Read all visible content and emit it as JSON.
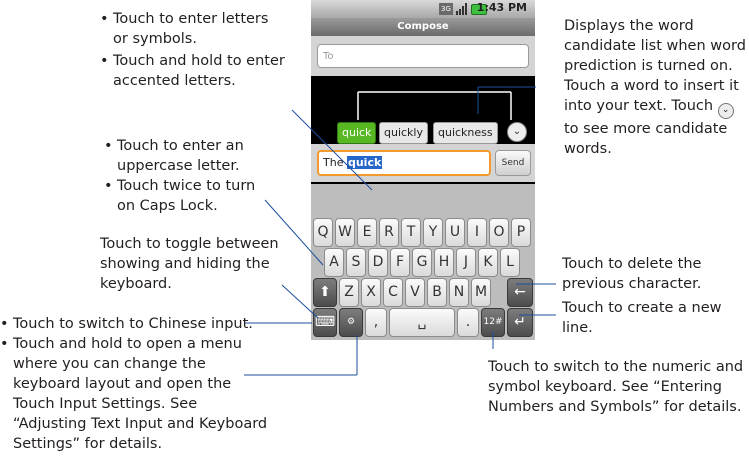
{
  "phone": {
    "status_time": "1:43 PM",
    "title": "Compose",
    "to_placeholder": "To",
    "candidates": [
      "quick",
      "quickly",
      "quickness"
    ],
    "text_prefix": "The ",
    "text_selected": "quick",
    "send_label": "Send",
    "row1": [
      "Q",
      "W",
      "E",
      "R",
      "T",
      "Y",
      "U",
      "I",
      "O",
      "P"
    ],
    "row2": [
      "A",
      "S",
      "D",
      "F",
      "G",
      "H",
      "J",
      "K",
      "L"
    ],
    "row3": [
      "Z",
      "X",
      "C",
      "V",
      "B",
      "N",
      "M"
    ],
    "key_comma": ",",
    "key_period": ".",
    "key_numeric": "12#"
  },
  "callouts": {
    "letters_1": "Touch to enter letters or symbols.",
    "letters_2": "Touch and hold to enter accented letters.",
    "upper_1": "Touch to enter an uppercase letter.",
    "upper_2": "Touch twice to turn on Caps Lock.",
    "toggle": "Touch to toggle between showing and hiding the keyboard.",
    "chinese_1": "Touch to switch to Chinese input.",
    "chinese_2": "Touch and hold to open a menu where you can change the keyboard layout and open the Touch Input Settings. See “Adjusting Text Input and Keyboard Settings” for details.",
    "candidate_a": "Displays the word candidate list when word prediction is turned on. Touch a word to insert it into your text. Touch",
    "candidate_b": "to see more candidate words.",
    "delete": "Touch to delete the previous character.",
    "newline": "Touch to create a new line.",
    "numeric": "Touch to switch to the numeric and symbol keyboard. See “Entering Numbers and Symbols” for details."
  }
}
